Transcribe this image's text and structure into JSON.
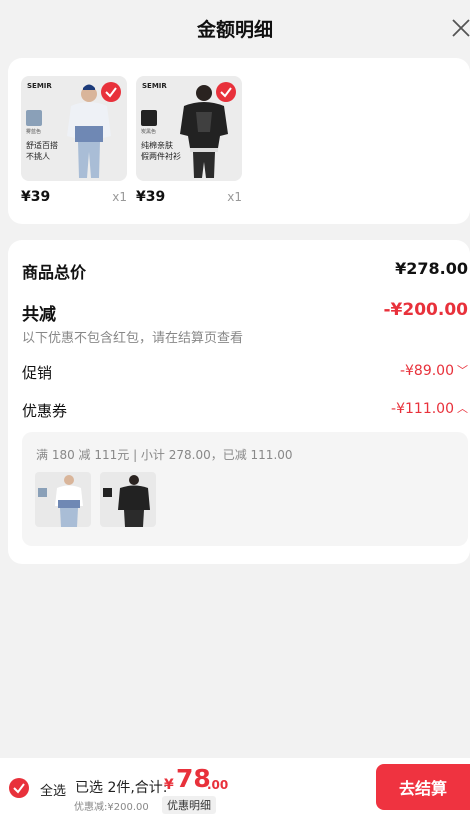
{
  "header": {
    "title": "金额明细"
  },
  "items": [
    {
      "brand": "SEMIR",
      "caption_line1": "舒适百搭",
      "caption_line2": "不挑人",
      "swatch_label": "雾蓝色",
      "price": "¥39",
      "qty": "x1",
      "swatch_color": "#8aa0b8"
    },
    {
      "brand": "SEMIR",
      "caption_line1": "纯棉亲肤",
      "caption_line2": "假两件衬衫",
      "swatch_label": "炭黑色",
      "price": "¥39",
      "qty": "x1",
      "swatch_color": "#222222"
    }
  ],
  "summary": {
    "total_label": "商品总价",
    "total_value": "¥278.00",
    "reduce_label": "共减",
    "reduce_value": "-¥200.00",
    "reduce_note": "以下优惠不包含红包，请在结算页查看",
    "promo_label": "促销",
    "promo_value": "-¥89.00",
    "promo_chevron": "﹀",
    "coupon_label": "优惠券",
    "coupon_value": "-¥111.00",
    "coupon_chevron": "︿",
    "coupon_detail": "满 180 减 111元 | 小计 278.00，已减 111.00"
  },
  "footer": {
    "select_all": "全选",
    "selected_text": "已选 2件,合计:",
    "currency": "¥",
    "total_int": "78",
    "total_dec": ".00",
    "discount_text": "优惠减:¥200.00",
    "detail_button": "优惠明细",
    "checkout_button": "去结算"
  },
  "colors": {
    "accent": "#e8313b",
    "checkout": "#ef3340",
    "background": "#f2f2f2"
  }
}
